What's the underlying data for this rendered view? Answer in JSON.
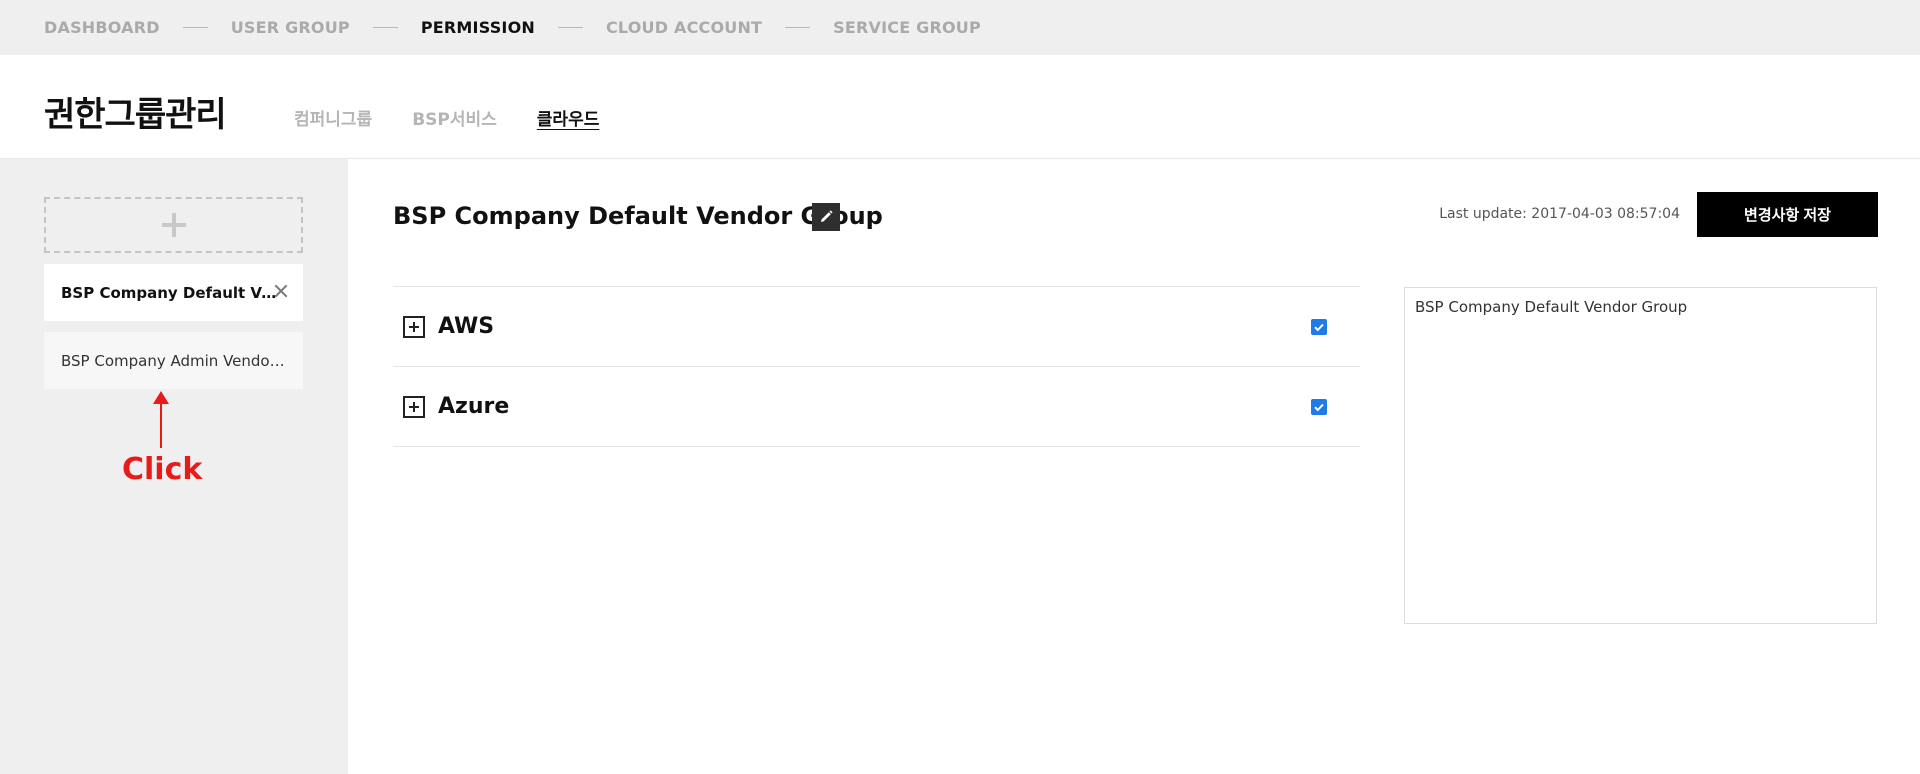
{
  "steps": [
    {
      "label": "DASHBOARD",
      "active": false
    },
    {
      "label": "USER GROUP",
      "active": false
    },
    {
      "label": "PERMISSION",
      "active": true
    },
    {
      "label": "CLOUD ACCOUNT",
      "active": false
    },
    {
      "label": "SERVICE GROUP",
      "active": false
    }
  ],
  "header": {
    "title": "권한그룹관리",
    "tabs": [
      {
        "label": "컴퍼니그룹",
        "active": false
      },
      {
        "label": "BSP서비스",
        "active": false
      },
      {
        "label": "클라우드",
        "active": true
      }
    ]
  },
  "sidebar": {
    "add_icon": "plus-icon",
    "groups": [
      {
        "label": "BSP Company Default Vendor Group",
        "active": true
      },
      {
        "label": "BSP Company Admin Vendor Group",
        "active": false
      }
    ],
    "annotation": {
      "text": "Click",
      "color": "#e81b1b"
    }
  },
  "main": {
    "group_title": "BSP Company Default Vendor Group",
    "last_update": "Last update: 2017-04-03 08:57:04",
    "save_label": "변경사항 저장",
    "providers": [
      {
        "name": "AWS",
        "checked": true
      },
      {
        "name": "Azure",
        "checked": true
      }
    ],
    "description": "BSP Company Default Vendor Group"
  },
  "colors": {
    "accent": "#1f7be8",
    "annotation": "#e81b1b",
    "nav_bg": "#efefef"
  }
}
